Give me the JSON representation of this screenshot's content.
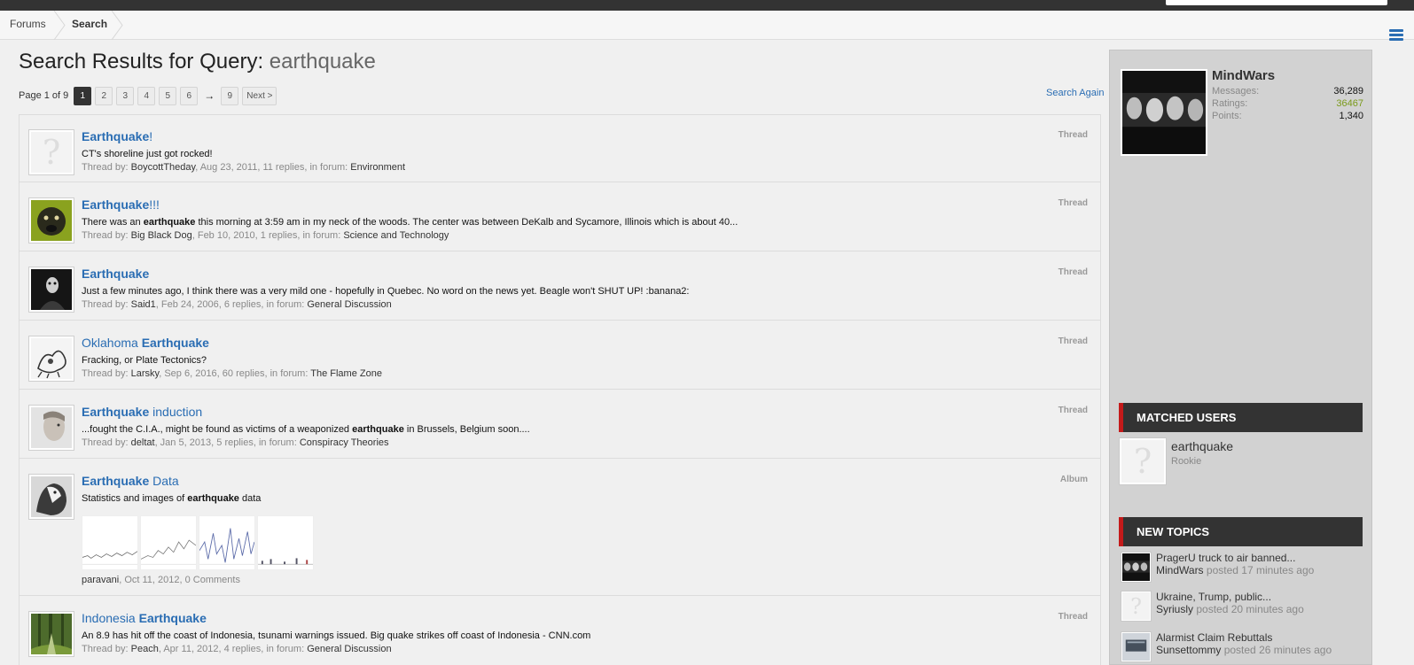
{
  "breadcrumb": {
    "items": [
      "Forums",
      "Search"
    ]
  },
  "page": {
    "title_prefix": "Search Results for Query:",
    "query": "earthquake",
    "search_again": "Search Again"
  },
  "pagination": {
    "label": "Page 1 of 9",
    "pages": [
      "1",
      "2",
      "3",
      "4",
      "5",
      "6"
    ],
    "arrow": "→",
    "last": "9",
    "next": "Next >"
  },
  "results": [
    {
      "title_pre": "",
      "title_bold": "Earthquake",
      "title_post": "!",
      "type": "Thread",
      "snippet_pre": "CT's shoreline just got rocked!",
      "snippet_bold": "",
      "snippet_post": "",
      "meta_prefix": "Thread by: ",
      "author": "BoycottTheday",
      "meta_mid": ", Aug 23, 2011, 11 replies, in forum: ",
      "forum": "Environment"
    },
    {
      "title_pre": "",
      "title_bold": "Earthquake",
      "title_post": "!!!",
      "type": "Thread",
      "snippet_pre": "There was an ",
      "snippet_bold": "earthquake",
      "snippet_post": " this morning at 3:59 am in my neck of the woods. The center was between DeKalb and Sycamore, Illinois which is about 40...",
      "meta_prefix": "Thread by: ",
      "author": "Big Black Dog",
      "meta_mid": ", Feb 10, 2010, 1 replies, in forum: ",
      "forum": "Science and Technology"
    },
    {
      "title_pre": "",
      "title_bold": "Earthquake",
      "title_post": "",
      "type": "Thread",
      "snippet_pre": "Just a few minutes ago, I think there was a very mild one - hopefully in Quebec. No word on the news yet. Beagle won't SHUT UP! :banana2:",
      "snippet_bold": "",
      "snippet_post": "",
      "meta_prefix": "Thread by: ",
      "author": "Said1",
      "meta_mid": ", Feb 24, 2006, 6 replies, in forum: ",
      "forum": "General Discussion"
    },
    {
      "title_pre": "Oklahoma ",
      "title_bold": "Earthquake",
      "title_post": "",
      "type": "Thread",
      "snippet_pre": "Fracking, or Plate Tectonics?",
      "snippet_bold": "",
      "snippet_post": "",
      "meta_prefix": "Thread by: ",
      "author": "Larsky",
      "meta_mid": ", Sep 6, 2016, 60 replies, in forum: ",
      "forum": "The Flame Zone"
    },
    {
      "title_pre": "",
      "title_bold": "Earthquake",
      "title_post": " induction",
      "type": "Thread",
      "snippet_pre": "...fought the C.I.A., might be found as victims of a weaponized ",
      "snippet_bold": "earthquake",
      "snippet_post": " in Brussels, Belgium soon....",
      "meta_prefix": "Thread by: ",
      "author": "deltat",
      "meta_mid": ", Jan 5, 2013, 5 replies, in forum: ",
      "forum": "Conspiracy Theories"
    },
    {
      "title_pre": "",
      "title_bold": "Earthquake",
      "title_post": " Data",
      "type": "Album",
      "snippet_pre": "Statistics and images of ",
      "snippet_bold": "earthquake",
      "snippet_post": " data",
      "meta_prefix": "",
      "author": "paravani",
      "meta_mid": ", Oct 11, 2012, 0 Comments",
      "forum": ""
    },
    {
      "title_pre": "Indonesia ",
      "title_bold": "Earthquake",
      "title_post": "",
      "type": "Thread",
      "snippet_pre": "An 8.9 has hit off the coast of Indonesia, tsunami warnings issued. Big quake strikes off coast of Indonesia - CNN.com",
      "snippet_bold": "",
      "snippet_post": "",
      "meta_prefix": "Thread by: ",
      "author": "Peach",
      "meta_mid": ", Apr 11, 2012, 4 replies, in forum: ",
      "forum": "General Discussion"
    }
  ],
  "visitor": {
    "name": "MindWars",
    "messages_label": "Messages:",
    "messages": "36,289",
    "ratings_label": "Ratings:",
    "ratings": "36467",
    "points_label": "Points:",
    "points": "1,340"
  },
  "matched_users": {
    "heading": "MATCHED USERS",
    "users": [
      {
        "name": "earthquake",
        "title": "Rookie"
      }
    ]
  },
  "new_topics": {
    "heading": "NEW TOPICS",
    "items": [
      {
        "title": "PragerU truck to air banned...",
        "user": "MindWars",
        "when": "posted 17 minutes ago"
      },
      {
        "title": "Ukraine, Trump, public...",
        "user": "Syriusly",
        "when": "posted 20 minutes ago"
      },
      {
        "title": "Alarmist Claim Rebuttals",
        "user": "Sunsettommy",
        "when": "posted 26 minutes ago"
      }
    ]
  },
  "colors": {
    "link": "#2a6db3",
    "header_bg": "#333333",
    "accent_red": "#c41a1a",
    "ratings_green": "#7a9a1a"
  }
}
